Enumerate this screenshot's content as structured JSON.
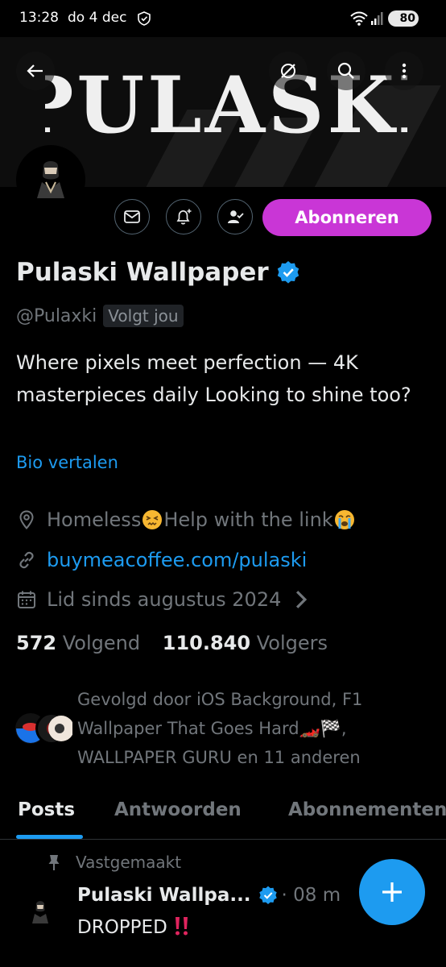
{
  "status_bar": {
    "time": "13:28",
    "date": "do 4 dec",
    "battery": "80"
  },
  "banner": {
    "logo_text": "PULASKI"
  },
  "actions": {
    "subscribe_label": "Abonneren"
  },
  "profile": {
    "name": "Pulaski Wallpaper",
    "handle": "@Pulaxki",
    "follows_you": "Volgt jou",
    "bio": "Where pixels meet perfection — 4K masterpieces daily Looking to shine too?",
    "translate_bio": "Bio vertalen",
    "location_text_1": "Homeless",
    "location_text_2": "Help with the link",
    "website": "buymeacoffee.com/pulaski",
    "joined": "Lid sinds augustus 2024",
    "following_count": "572",
    "following_label": "Volgend",
    "followers_count": "110.840",
    "followers_label": "Volgers",
    "followed_by": "Gevolgd door iOS Background, F1 Wallpaper That Goes Hard🏎️🏁, WALLPAPER GURU en 11 anderen"
  },
  "tabs": [
    {
      "label": "Posts",
      "active": true
    },
    {
      "label": "Antwoorden",
      "active": false
    },
    {
      "label": "Abonnementen",
      "active": false
    }
  ],
  "post": {
    "pinned_label": "Vastgemaakt",
    "author": "Pulaski Wallpa...",
    "time": "· 08 m",
    "text": "DROPPED"
  },
  "colors": {
    "accent": "#1d9bf0",
    "subscribe": "#c936d6",
    "background": "#000000",
    "muted": "#71767b"
  }
}
